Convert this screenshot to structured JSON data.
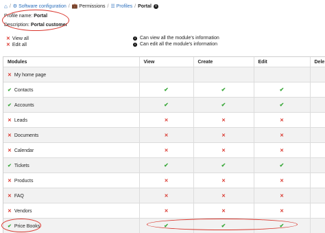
{
  "breadcrumb": {
    "items": [
      {
        "label": "",
        "icon": "home-icon",
        "link": true
      },
      {
        "label": "Software configuration",
        "icon": "gear-icon",
        "link": true
      },
      {
        "label": "Permissions",
        "icon": "briefcase-icon",
        "link": false
      },
      {
        "label": "Profiles",
        "icon": "list-icon",
        "link": true
      },
      {
        "label": "Portal",
        "icon": "info-icon",
        "link": false
      }
    ]
  },
  "profile": {
    "name_label": "Profile name:",
    "name_value": "Portal",
    "description_label": "Description:",
    "description_value": "Portal customer"
  },
  "legend": {
    "view_all": "View all",
    "edit_all": "Edit all",
    "view_info": "Can view all the module's information",
    "edit_info": "Can edit all the module's information"
  },
  "table": {
    "headers": [
      "Modules",
      "View",
      "Create",
      "Edit",
      "Dele"
    ],
    "rows": [
      {
        "module": "My home page",
        "enabled": false,
        "view": "",
        "create": "",
        "edit": ""
      },
      {
        "module": "Contacts",
        "enabled": true,
        "view": "yes",
        "create": "yes",
        "edit": "yes"
      },
      {
        "module": "Accounts",
        "enabled": true,
        "view": "yes",
        "create": "yes",
        "edit": "yes"
      },
      {
        "module": "Leads",
        "enabled": false,
        "view": "no",
        "create": "no",
        "edit": "no"
      },
      {
        "module": "Documents",
        "enabled": false,
        "view": "no",
        "create": "no",
        "edit": "no"
      },
      {
        "module": "Calendar",
        "enabled": false,
        "view": "no",
        "create": "no",
        "edit": "no"
      },
      {
        "module": "Tickets",
        "enabled": true,
        "view": "yes",
        "create": "yes",
        "edit": "yes"
      },
      {
        "module": "Products",
        "enabled": false,
        "view": "no",
        "create": "no",
        "edit": "no"
      },
      {
        "module": "FAQ",
        "enabled": false,
        "view": "no",
        "create": "no",
        "edit": "no"
      },
      {
        "module": "Vendors",
        "enabled": false,
        "view": "no",
        "create": "no",
        "edit": "no"
      },
      {
        "module": "Price Books",
        "enabled": true,
        "view": "yes",
        "create": "yes",
        "edit": "yes"
      }
    ]
  },
  "colors": {
    "check": "#3aa83a",
    "cross": "#d9342b",
    "link": "#2a6ebb",
    "annotation": "#d9342b"
  }
}
